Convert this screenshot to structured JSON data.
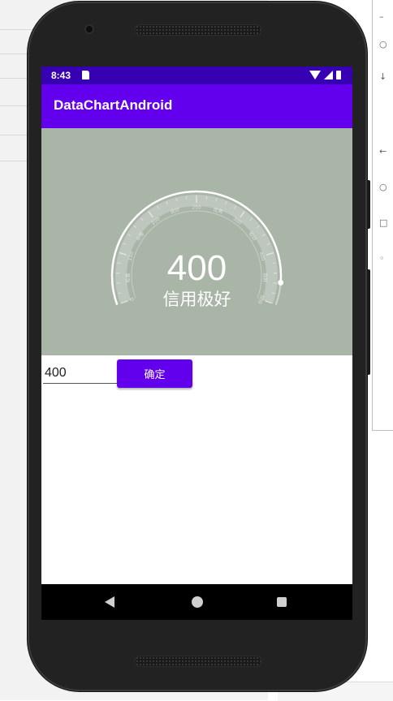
{
  "status_bar": {
    "time": "8:43"
  },
  "app_bar": {
    "title": "DataChartAndroid"
  },
  "gauge": {
    "value": "400",
    "status": "信用极好",
    "progress_fraction": 0.93,
    "tick_labels": [
      "0",
      "较差",
      "150",
      "中等",
      "200",
      "良好",
      "250",
      "优秀",
      "300",
      "较好",
      "400",
      "极好",
      "500"
    ],
    "colors": {
      "background": "#a9b5a7",
      "arc": "#ffffff"
    }
  },
  "input": {
    "value": "400"
  },
  "buttons": {
    "confirm_label": "确定"
  },
  "colors": {
    "primary": "#6200ee",
    "primary_dark": "#3700b3"
  },
  "icons": {
    "sd_card": "sd-card-icon",
    "wifi": "wifi-icon",
    "signal": "signal-icon",
    "battery": "battery-icon",
    "back": "back-icon",
    "home": "home-icon",
    "recents": "recents-icon"
  }
}
